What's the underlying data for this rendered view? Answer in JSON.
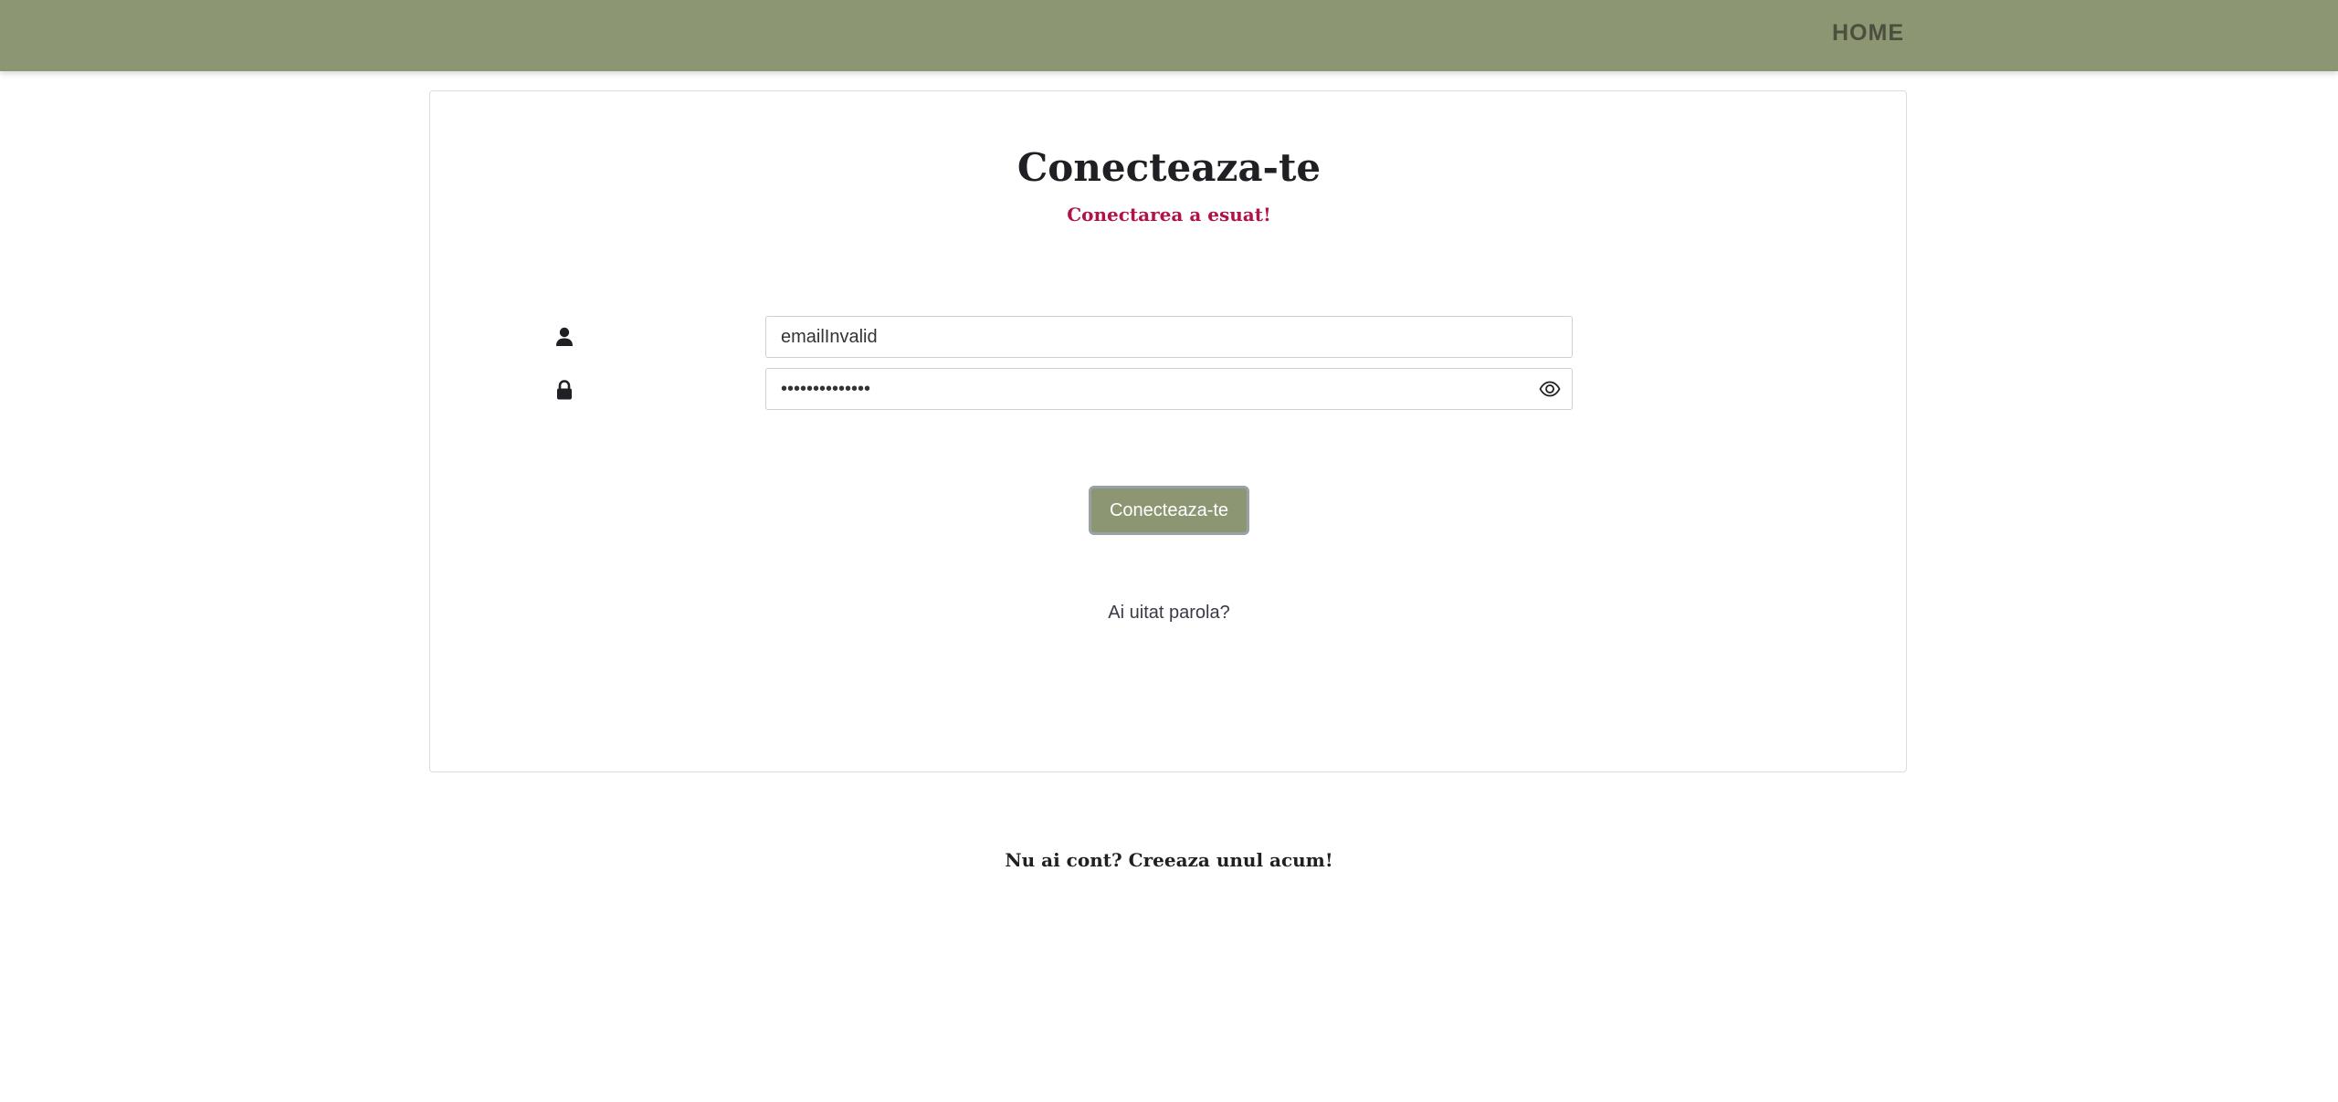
{
  "nav": {
    "home_label": "HOME"
  },
  "login": {
    "title": "Conecteaza-te",
    "error_message": "Conectarea a esuat!",
    "email_value": "emailInvalid",
    "password_value": "••••••••••••••",
    "submit_label": "Conecteaza-te",
    "forgot_password": "Ai uitat parola?"
  },
  "signup": {
    "prompt": "Nu ai cont?",
    "link_label": "Creeaza unul acum!"
  },
  "colors": {
    "navbar": "#8d9673",
    "error": "#b0124a",
    "button": "#8d9673"
  },
  "icons": {
    "user": "user-icon",
    "lock": "lock-icon",
    "eye": "eye-icon"
  }
}
